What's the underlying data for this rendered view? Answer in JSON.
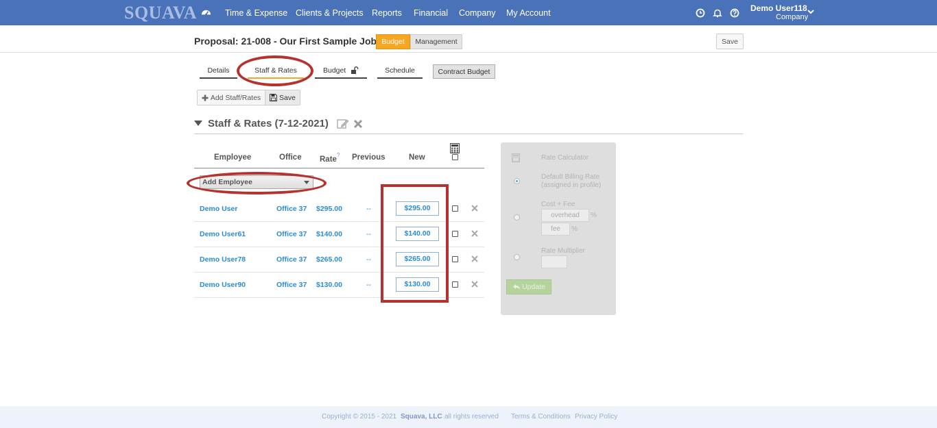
{
  "header": {
    "logo": "SQUAVA",
    "nav": [
      "Time & Expense",
      "Clients & Projects",
      "Reports",
      "Financial",
      "Company",
      "My Account"
    ],
    "user_name": "Demo User118",
    "user_company": "Company"
  },
  "title": {
    "proposal": "Proposal: 21-008 - Our First Sample Job",
    "toggle_budget": "Budget",
    "toggle_management": "Management",
    "save": "Save"
  },
  "subtabs": {
    "details": "Details",
    "staff_rates": "Staff & Rates",
    "budget": "Budget",
    "schedule": "Schedule",
    "contract_budget": "Contract Budget"
  },
  "toolbar": {
    "add_staff": "Add Staff/Rates",
    "save": "Save"
  },
  "section": {
    "title": "Staff & Rates (7-12-2021)"
  },
  "table": {
    "headers": {
      "employee": "Employee",
      "office": "Office",
      "rate": "Rate",
      "rate_sup": "?",
      "previous": "Previous",
      "new": "New"
    },
    "add_employee": "Add Employee",
    "rows": [
      {
        "employee": "Demo User",
        "office": "Office 37",
        "rate": "$295.00",
        "previous": "--",
        "new": "$295.00"
      },
      {
        "employee": "Demo User61",
        "office": "Office 37",
        "rate": "$140.00",
        "previous": "--",
        "new": "$140.00"
      },
      {
        "employee": "Demo User78",
        "office": "Office 37",
        "rate": "$265.00",
        "previous": "--",
        "new": "$265.00"
      },
      {
        "employee": "Demo User90",
        "office": "Office 37",
        "rate": "$130.00",
        "previous": "--",
        "new": "$130.00"
      }
    ]
  },
  "calculator": {
    "title": "Rate Calculator",
    "default_line1": "Default Billing Rate",
    "default_line2": "(assigned in profile)",
    "cost_fee": "Cost + Fee",
    "overhead_placeholder": "overhead",
    "fee_placeholder": "fee",
    "percent": "%",
    "multiplier": "Rate Multiplier",
    "update": "Update"
  },
  "footer": {
    "copyright": "Copyright © 2015 - 2021",
    "company": "Squava, LLC",
    "rights": "all rights reserved",
    "terms": "Terms & Conditions",
    "privacy": "Privacy Policy"
  },
  "colors": {
    "topbar": "#4a72b8",
    "accent": "#f5a623",
    "link": "#2a8bd6",
    "annotation": "#b6322f"
  }
}
